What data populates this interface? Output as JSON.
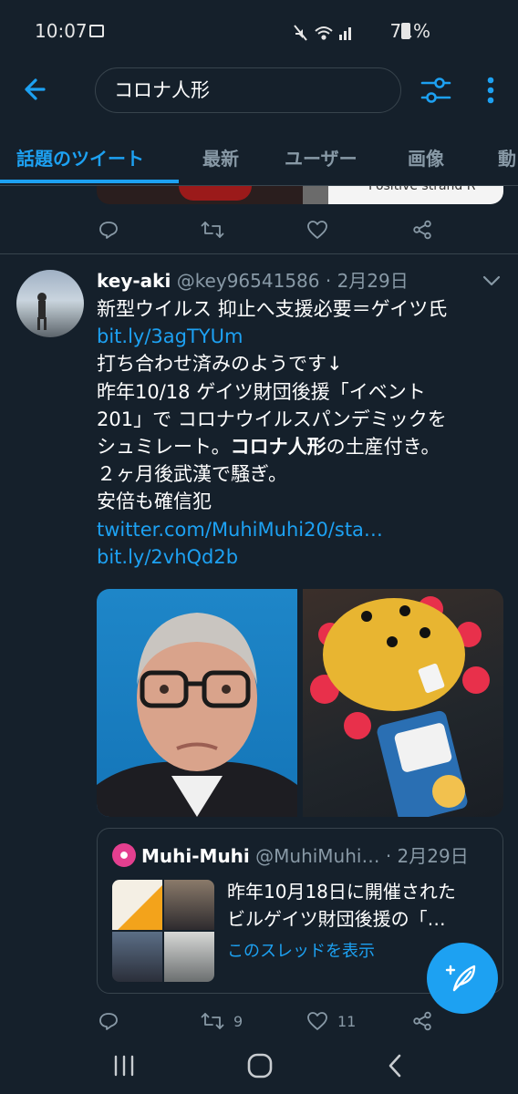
{
  "status_bar": {
    "time": "10:07",
    "battery": "71%",
    "icons": [
      "gallery-icon",
      "mute-icon",
      "wifi-icon",
      "signal-icon",
      "battery-icon"
    ]
  },
  "search": {
    "query": "コロナ人形"
  },
  "tabs": [
    "話題のツイート",
    "最新",
    "ユーザー",
    "画像",
    "動"
  ],
  "previous_tweet": {
    "media_text": "Positive strand R"
  },
  "tweet": {
    "name": "key-aki",
    "handle": "@key96541586",
    "separator": " · ",
    "date": "2月29日",
    "lines": [
      "新型ウイルス 抑止へ支援必要＝ゲイツ氏",
      "bit.ly/3agTYUm",
      "打ち合わせ済みのようです↓",
      "昨年10/18 ゲイツ財団後援「イベント",
      "201」で コロナウイルスパンデミックを",
      "シュミレート。",
      "コロナ人形",
      "の土産付き。",
      "２ヶ月後武漢で騒ぎ。",
      "安倍も確信犯",
      "twitter.com/MuhiMuhi20/sta…",
      "bit.ly/2vhQd2b"
    ],
    "quote": {
      "name": "Muhi-Muhi",
      "handle": "@MuhiMuhi…",
      "separator": " · ",
      "date": "2月29日",
      "text_lines": [
        "昨年10月18日に開催された",
        "ビルゲイツ財団後援の「…"
      ],
      "show_thread": "このスレッドを表示"
    },
    "retweet_count": "9",
    "like_count": "11"
  },
  "colors": {
    "background": "#15202b",
    "accent": "#1da1f2",
    "secondary_text": "#8899a6",
    "border": "#38444d"
  }
}
